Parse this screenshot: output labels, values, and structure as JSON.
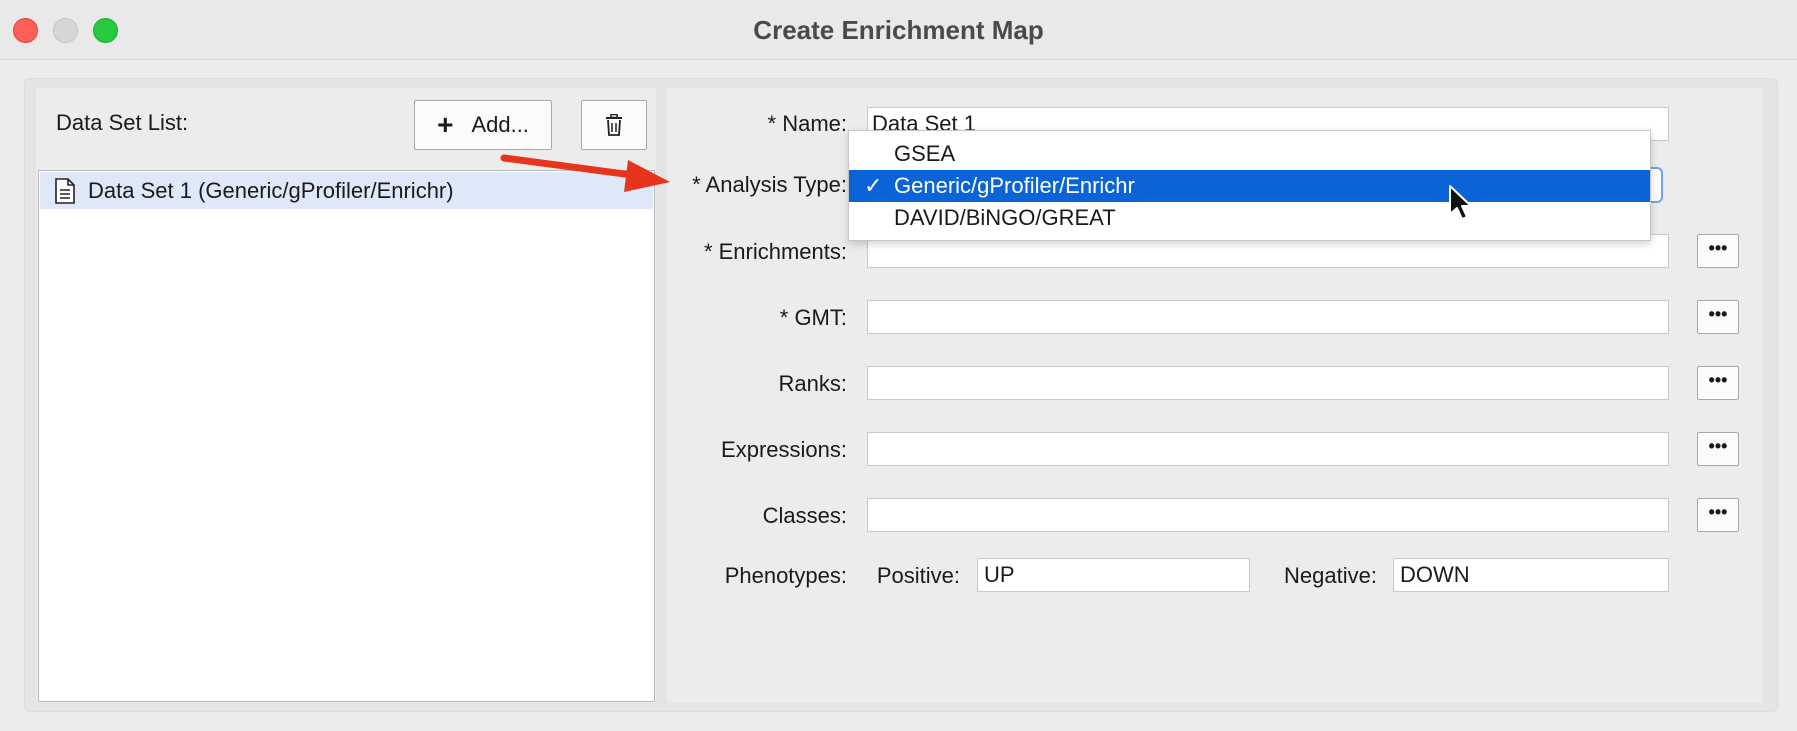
{
  "window": {
    "title": "Create Enrichment Map",
    "colors": {
      "close": "#fe5f57",
      "minimize": "#d6d6d6",
      "zoom": "#28c840"
    }
  },
  "left": {
    "dataset_list_label": "Data Set List:",
    "add_button_label": "Add...",
    "add_icon": "plus-icon",
    "delete_icon": "trash-icon",
    "items": [
      {
        "label": "Data Set 1  (Generic/gProfiler/Enrichr)",
        "icon": "document-icon",
        "selected": true
      }
    ]
  },
  "form": {
    "name_label": "* Name:",
    "name_value": "Data Set 1",
    "analysis_type_label": "* Analysis Type:",
    "enrichments_label": "* Enrichments:",
    "gmt_label": "* GMT:",
    "ranks_label": "Ranks:",
    "expressions_label": "Expressions:",
    "classes_label": "Classes:",
    "phenotypes_label": "Phenotypes:",
    "positive_label": "Positive:",
    "positive_value": "UP",
    "negative_label": "Negative:",
    "negative_value": "DOWN",
    "browse_button_label": "•••"
  },
  "dropdown": {
    "options": [
      "GSEA",
      "Generic/gProfiler/Enrichr",
      "DAVID/BiNGO/GREAT"
    ],
    "selected": "Generic/gProfiler/Enrichr",
    "check_mark": "✓",
    "highlight_color": "#0a64d8"
  },
  "annotation": {
    "arrow_color": "#e8341c"
  }
}
